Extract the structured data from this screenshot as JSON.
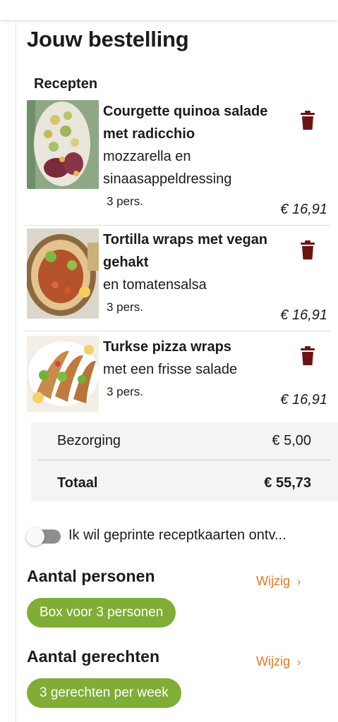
{
  "order": {
    "title": "Jouw bestelling",
    "recipes_label": "Recepten",
    "recipes": [
      {
        "name": "Courgette quinoa salade met radicchio",
        "subtitle": "mozzarella en sinaasappeldressing",
        "persons": "3 pers.",
        "price": "€ 16,91",
        "image_icon": "courgette-quinoa-salad-image"
      },
      {
        "name": "Tortilla wraps met vegan gehakt",
        "subtitle": "en tomatensalsa",
        "persons": "3 pers.",
        "price": "€ 16,91",
        "image_icon": "tortilla-wraps-image"
      },
      {
        "name": "Turkse pizza wraps",
        "subtitle": "met een frisse salade",
        "persons": "3 pers.",
        "price": "€ 16,91",
        "image_icon": "turkish-pizza-wraps-image"
      }
    ]
  },
  "totals": {
    "delivery_label": "Bezorging",
    "delivery_value": "€ 5,00",
    "total_label": "Totaal",
    "total_value": "€ 55,73"
  },
  "print_cards": {
    "label": "Ik wil geprinte receptkaarten ontv...",
    "enabled": false
  },
  "persons_section": {
    "heading": "Aantal personen",
    "edit_label": "Wijzig",
    "chevron": "›",
    "value": "Box voor 3 personen"
  },
  "dishes_section": {
    "heading": "Aantal gerechten",
    "edit_label": "Wijzig",
    "chevron": "›",
    "value": "3 gerechten per week"
  },
  "colors": {
    "accent_orange": "#e8771e",
    "pill_green": "#7fad35",
    "trash_dark_red": "#6b1414",
    "toggle_off": "#8f8f8f"
  }
}
